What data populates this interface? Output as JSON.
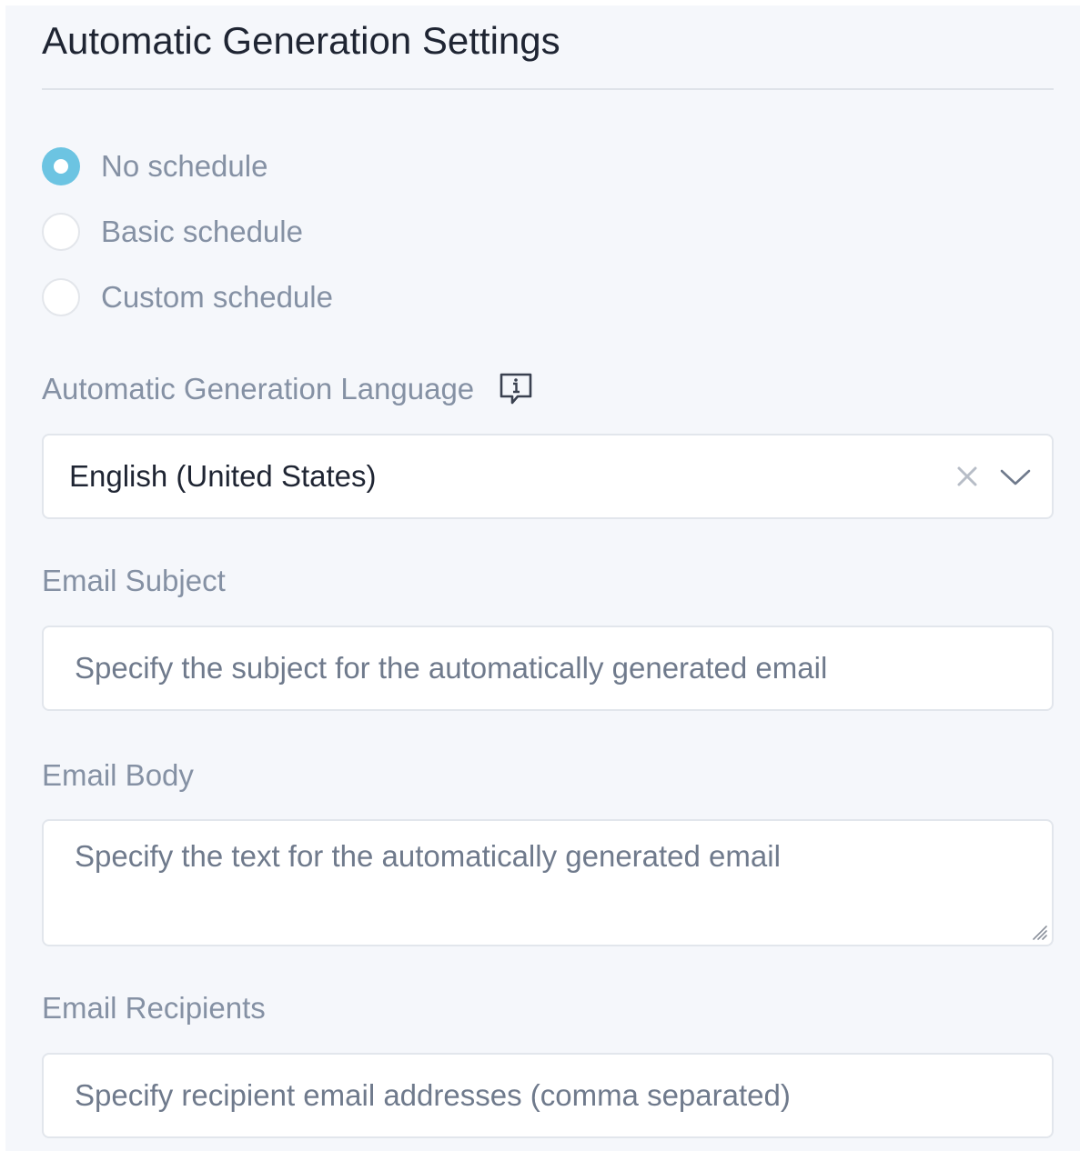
{
  "section": {
    "title": "Automatic Generation Settings"
  },
  "schedule": {
    "options": [
      {
        "label": "No schedule",
        "checked": true
      },
      {
        "label": "Basic schedule",
        "checked": false
      },
      {
        "label": "Custom schedule",
        "checked": false
      }
    ]
  },
  "language": {
    "label": "Automatic Generation Language",
    "info_icon": "info-speech-bubble-icon",
    "selected": "English (United States)",
    "clear_icon": "close-icon",
    "dropdown_icon": "chevron-down-icon"
  },
  "email_subject": {
    "label": "Email Subject",
    "value": "",
    "placeholder": "Specify the subject for the automatically generated email"
  },
  "email_body": {
    "label": "Email Body",
    "value": "",
    "placeholder": "Specify the text for the automatically generated email"
  },
  "email_recipients": {
    "label": "Email Recipients",
    "value": "",
    "placeholder": "Specify recipient email addresses (comma separated)"
  },
  "colors": {
    "accent": "#6cc4e2",
    "label_text": "#8591a4",
    "title_text": "#1f2533",
    "panel_bg": "#f5f7fb"
  }
}
